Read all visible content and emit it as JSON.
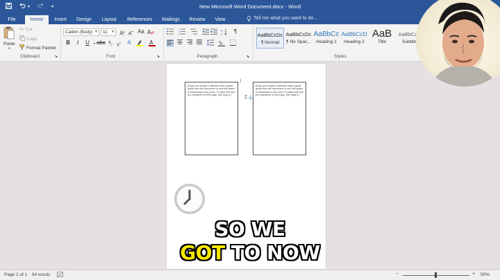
{
  "title_bar": {
    "document_title": "New Microsoft Word Document.docx - Word",
    "qat_icons": [
      "save-icon",
      "undo-icon",
      "redo-icon",
      "customize-icon"
    ]
  },
  "tabs": [
    "File",
    "Home",
    "Insert",
    "Design",
    "Layout",
    "References",
    "Mailings",
    "Review",
    "View"
  ],
  "active_tab": "Home",
  "tell_me": {
    "placeholder": "Tell me what you want to do..."
  },
  "clipboard": {
    "paste": "Paste",
    "cut": "Cut",
    "copy": "Copy",
    "format_painter": "Format Painter",
    "label": "Clipboard"
  },
  "font": {
    "name": "Calibri (Body)",
    "size": "11",
    "label": "Font",
    "bold": "B",
    "italic": "I",
    "underline": "U",
    "font_color": "#c00000",
    "highlight_color": "#ffff00"
  },
  "paragraph": {
    "label": "Paragraph",
    "pilcrow": "¶"
  },
  "styles": {
    "label": "Styles",
    "items": [
      {
        "sample": "AaBbCcDc",
        "name": "¶ Normal"
      },
      {
        "sample": "AaBbCcDc",
        "name": "¶ No Spac..."
      },
      {
        "sample": "AaBbCc",
        "name": "Heading 1"
      },
      {
        "sample": "AaBbCcD",
        "name": "Heading 2"
      },
      {
        "sample": "AaB",
        "name": "Title"
      },
      {
        "sample": "AaBbCcD",
        "name": "Subtitle"
      }
    ]
  },
  "document": {
    "quote_text": "[Grab your reader's attention with a great quote from the document or use this space to emphasize a key point. To place this text box anywhere on the page, just drag it.]",
    "quote_text_2": "[Grab your reader's attention with a great quote from the document or use this space to emphasize a key point. To place this text box anywhere on the page, just drag it.]"
  },
  "status": {
    "page": "Page 1 of 1",
    "words": "64 words",
    "zoom": "50%"
  },
  "caption": {
    "line1": "SO WE",
    "highlight": "GOT",
    "line2_rest": "TO NOW"
  },
  "colors": {
    "word_blue": "#2b579a",
    "caption_yellow": "#f6e600"
  }
}
